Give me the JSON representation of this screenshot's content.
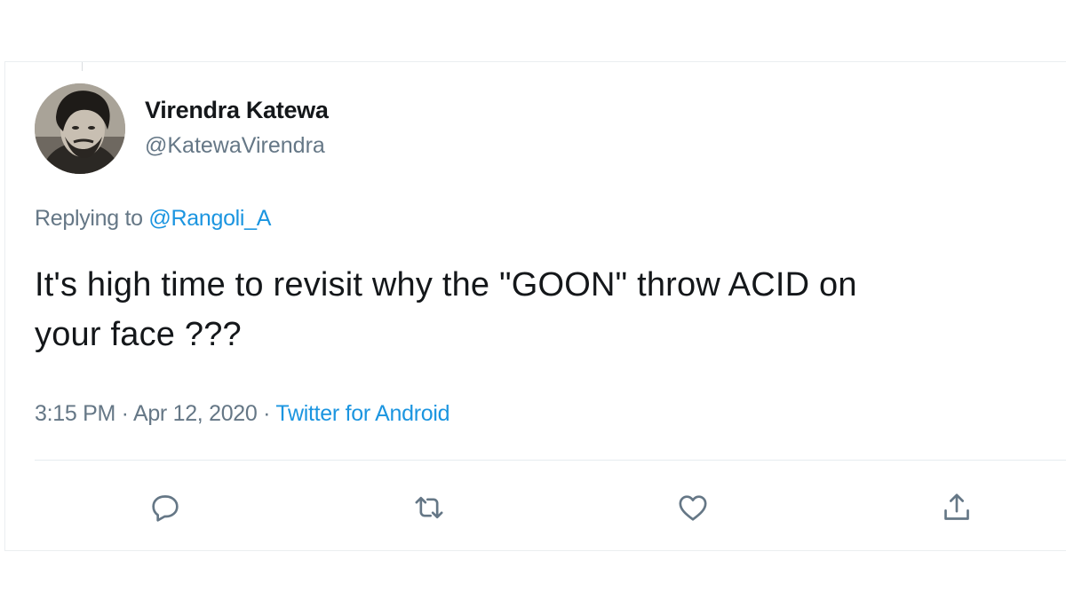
{
  "tweet": {
    "author": {
      "display_name": "Virendra Katewa",
      "handle": "@KatewaVirendra",
      "avatar_icon": "profile-photo"
    },
    "reply": {
      "prefix": "Replying to ",
      "mention": "@Rangoli_A"
    },
    "text_line_1": "It's high time to revisit why the \"GOON\" throw ACID on",
    "text_line_2": "your face ???",
    "time": "3:15 PM",
    "separator_1": " · ",
    "date": "Apr 12, 2020",
    "separator_2": " · ",
    "source": "Twitter for Android"
  },
  "actions": [
    {
      "name": "reply",
      "icon": "reply-icon"
    },
    {
      "name": "retweet",
      "icon": "retweet-icon"
    },
    {
      "name": "like",
      "icon": "heart-icon"
    },
    {
      "name": "share",
      "icon": "share-icon"
    }
  ],
  "colors": {
    "text_primary": "#14171a",
    "text_secondary": "#657786",
    "link": "#1b95e0",
    "border": "#e6ecf0"
  }
}
